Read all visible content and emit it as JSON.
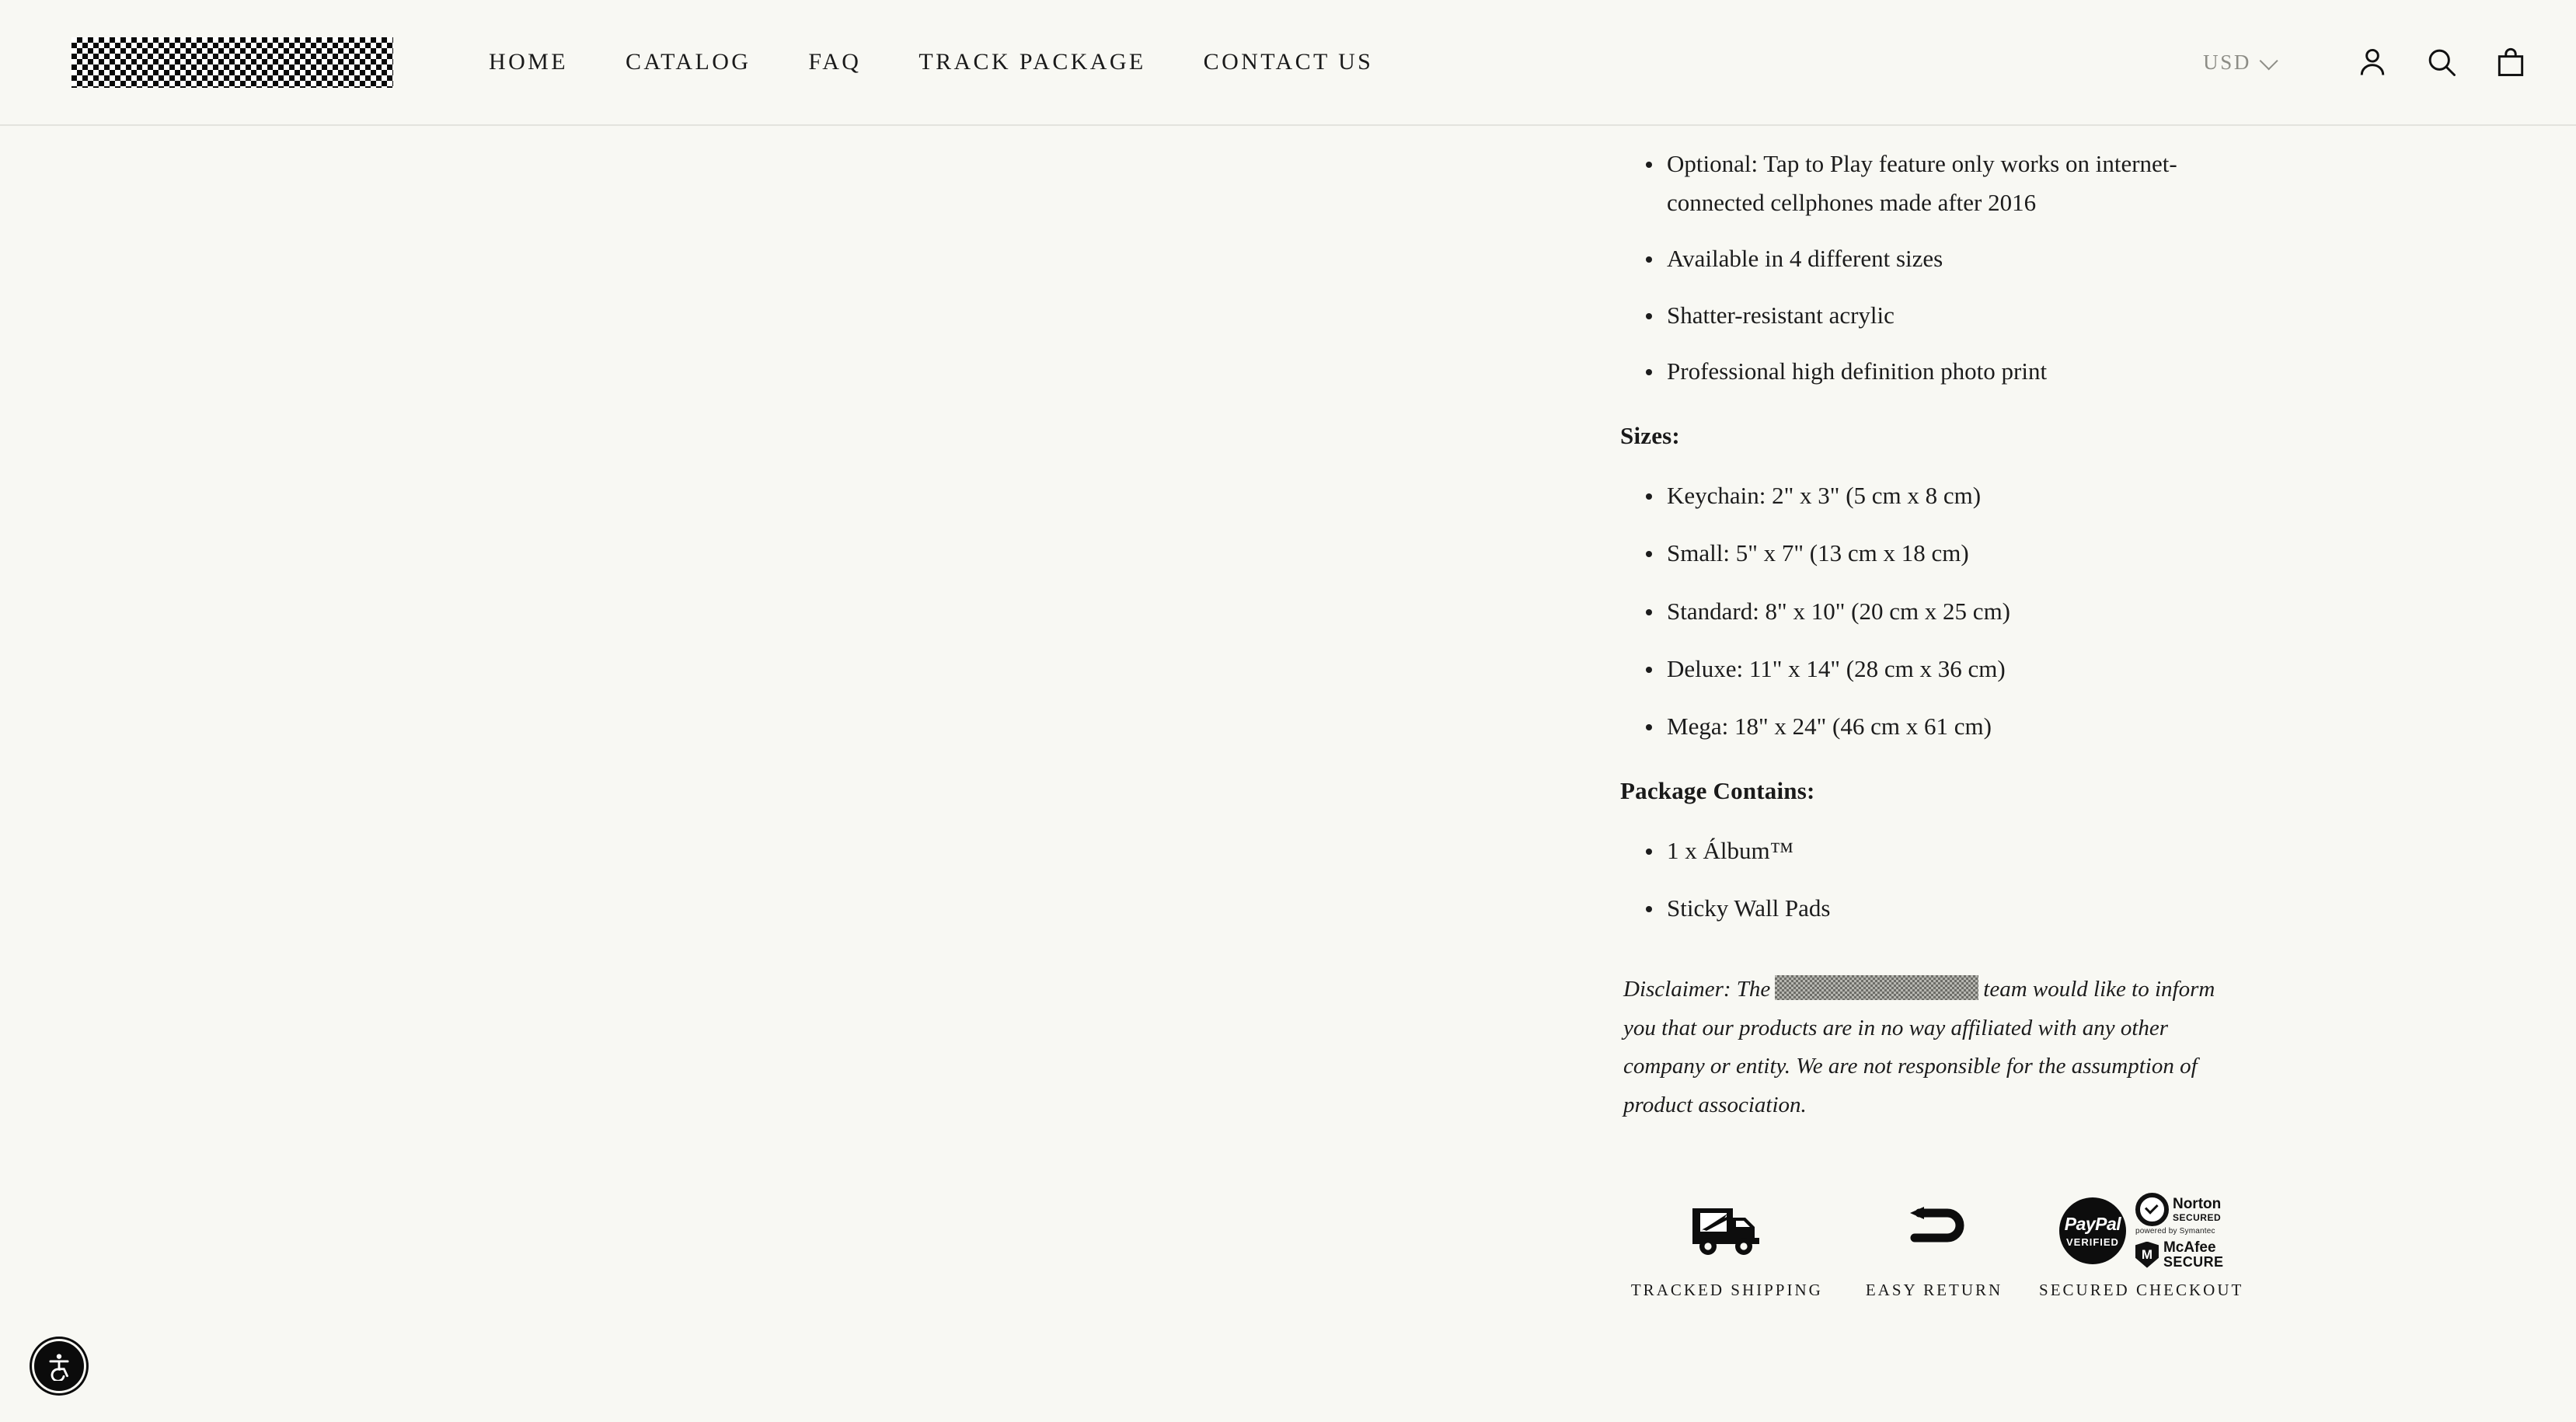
{
  "header": {
    "logo_alt": "redacted-brand-logo",
    "nav": [
      {
        "label": "HOME"
      },
      {
        "label": "CATALOG"
      },
      {
        "label": "FAQ"
      },
      {
        "label": "TRACK PACKAGE"
      },
      {
        "label": "CONTACT US"
      }
    ],
    "currency": "USD",
    "icons": {
      "account": "account-icon",
      "search": "search-icon",
      "cart": "cart-icon"
    }
  },
  "product_description": {
    "features": [
      "Optional: Tap to Play feature  only works on internet-connected cellphones made after 2016",
      "Available in 4 different sizes",
      "Shatter-resistant acrylic",
      "Professional  high definition  photo print"
    ],
    "sizes_heading": "Sizes:",
    "sizes": [
      "Keychain: 2\" x 3\" (5 cm x 8 cm)",
      "Small: 5\" x 7\" (13 cm x 18 cm)",
      "Standard: 8\" x 10\" (20 cm x 25 cm)",
      "Deluxe: 11\" x 14\" (28 cm x 36 cm)",
      "Mega: 18\" x 24\" (46 cm x 61 cm)"
    ],
    "package_heading": "Package Contains:",
    "package_contents": [
      "1 x Álbum™",
      "Sticky Wall Pads"
    ],
    "disclaimer": {
      "before": "Disclaimer: The",
      "redacted": "redacted-brand-name",
      "after": "team would like to inform you that our products are in no way affiliated with any other company or entity. We are not responsible for the assumption of product association."
    }
  },
  "trust_badges": [
    {
      "icon": "mail-truck-icon",
      "label": "TRACKED SHIPPING"
    },
    {
      "icon": "return-arrow-icon",
      "label": "EASY RETURN"
    },
    {
      "icon": "secure-checkout-logos",
      "label": "SECURED CHECKOUT"
    }
  ],
  "secure_logos": {
    "paypal_name": "PayPal",
    "paypal_verified": "VERIFIED",
    "norton_name": "Norton",
    "norton_secured": "SECURED",
    "norton_powered": "powered by Symantec",
    "mcafee_name": "McAfee",
    "mcafee_secure": "SECURE"
  },
  "accessibility": {
    "label": "accessibility-widget"
  },
  "colors": {
    "background": "#f8f8f3",
    "text": "#1a1a1a",
    "muted": "#8d8d86",
    "border": "#e3e3dd",
    "redaction": "#b6b6b0"
  }
}
